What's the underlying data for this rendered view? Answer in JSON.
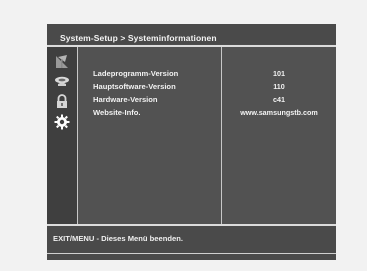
{
  "header": {
    "title": "System-Setup > Systeminformationen"
  },
  "sidebar": {
    "icons": [
      {
        "name": "antenna-icon",
        "state": "dimmed"
      },
      {
        "name": "satellite-dish-icon",
        "state": "normal"
      },
      {
        "name": "lock-icon",
        "state": "normal"
      },
      {
        "name": "gear-icon",
        "state": "selected"
      }
    ]
  },
  "info": {
    "rows": [
      {
        "label": "Ladeprogramm-Version",
        "value": "101"
      },
      {
        "label": "Hauptsoftware-Version",
        "value": "110"
      },
      {
        "label": "Hardware-Version",
        "value": "c41"
      },
      {
        "label": "Website-Info.",
        "value": "www.samsungstb.com"
      }
    ]
  },
  "footer": {
    "help_text": "EXIT/MENU - Dieses Menü beenden."
  },
  "colors": {
    "page_background": "#f2f2f2",
    "screen_background": "#4d4d4d",
    "sidebar_background": "#3f3f3f",
    "text": "#f2f2f2",
    "divider": "#dcdcdc"
  }
}
